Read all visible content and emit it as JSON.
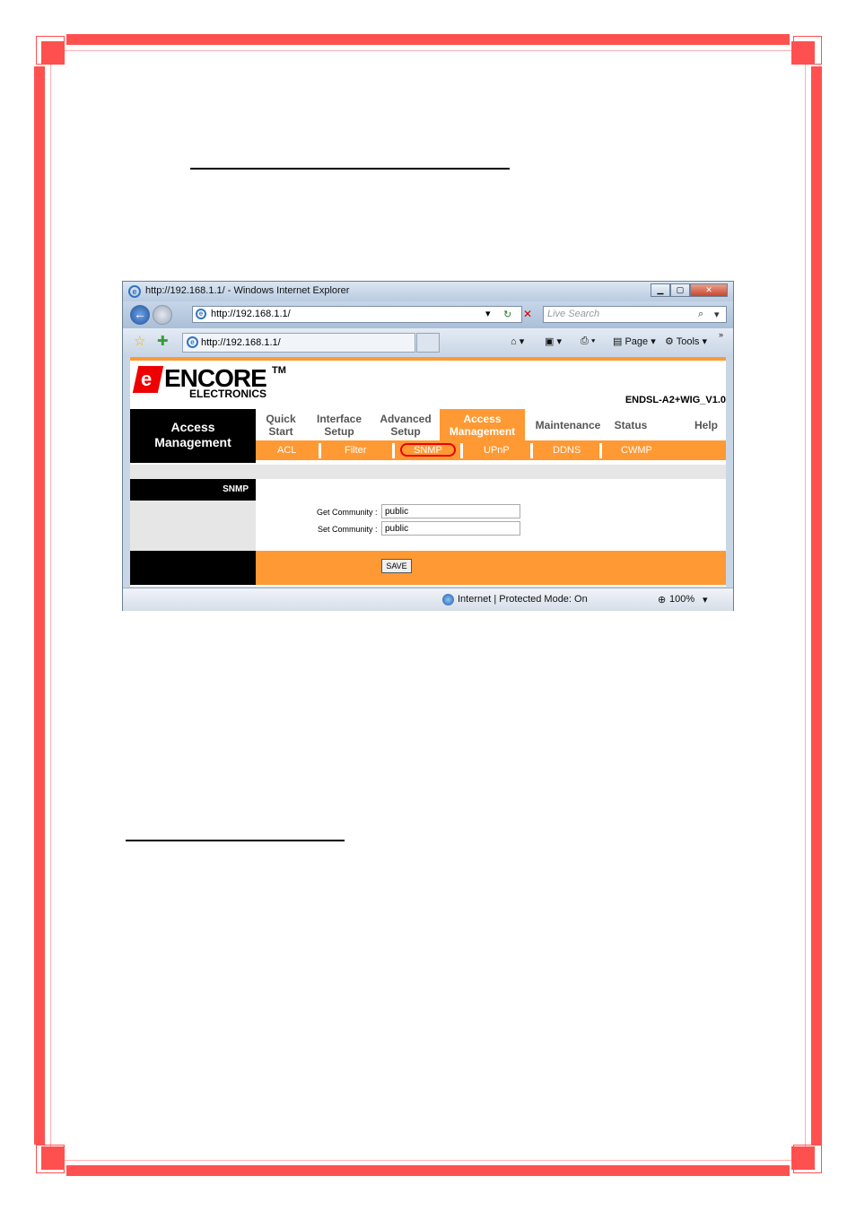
{
  "browser": {
    "title": "http://192.168.1.1/ - Windows Internet Explorer",
    "address": "http://192.168.1.1/",
    "search_placeholder": "Live Search",
    "tab_label": "http://192.168.1.1/",
    "cmd_page": "Page",
    "cmd_tools": "Tools",
    "status_zone": "Internet | Protected Mode: On",
    "zoom": "100%"
  },
  "router": {
    "logo": "ENCORE",
    "logo_tm": "TM",
    "logo_sub": "ELECTRONICS",
    "model": "ENDSL-A2+WIG_V1.0",
    "section_title_line1": "Access",
    "section_title_line2": "Management",
    "menu": [
      {
        "l1": "Quick",
        "l2": "Start"
      },
      {
        "l1": "Interface",
        "l2": "Setup"
      },
      {
        "l1": "Advanced",
        "l2": "Setup"
      },
      {
        "l1": "Access",
        "l2": "Management"
      },
      {
        "l1": "Maintenance",
        "l2": ""
      },
      {
        "l1": "Status",
        "l2": ""
      },
      {
        "l1": "Help",
        "l2": ""
      }
    ],
    "submenu": [
      "ACL",
      "Filter",
      "SNMP",
      "UPnP",
      "DDNS",
      "CWMP"
    ],
    "panel_title": "SNMP",
    "get_community_label": "Get Community :",
    "get_community_value": "public",
    "set_community_label": "Set Community :",
    "set_community_value": "public",
    "save_label": "SAVE"
  },
  "colors": {
    "border": "#ff5050",
    "accent": "#ff9933"
  }
}
